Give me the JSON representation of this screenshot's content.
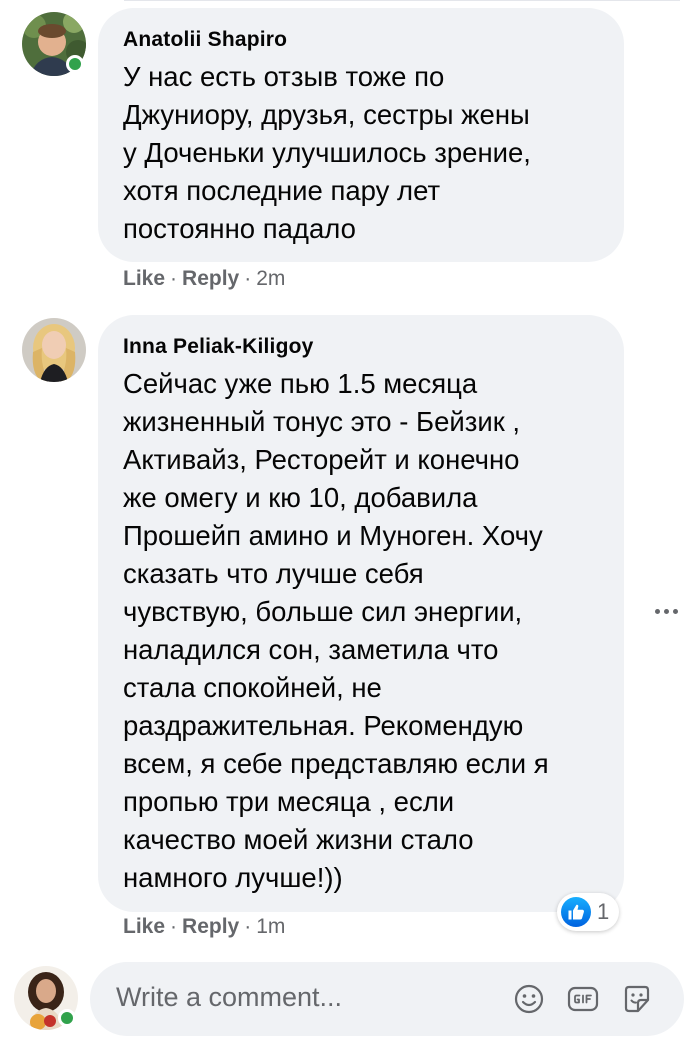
{
  "comments": [
    {
      "author": "Anatolii Shapiro",
      "online": true,
      "lines": [
        "У нас есть отзыв тоже по",
        "Джуниору, друзья, сестры жены",
        "у Доченьки улучшилось зрение,",
        "хотя последние пару лет",
        "постоянно падало"
      ],
      "like_label": "Like",
      "reply_label": "Reply",
      "time": "2m"
    },
    {
      "author": "Inna Peliak-Kiligoy",
      "online": false,
      "lines": [
        "Сейчас уже пью 1.5 месяца",
        "жизненный тонус это - Бейзик ,",
        "Активайз, Ресторейт и конечно",
        "же омегу и кю 10, добавила",
        "Прошейп амино и Муноген. Хочу",
        "сказать что лучше себя",
        "чувствую, больше сил энергии,",
        "наладился сон, заметила что",
        "стала спокойней, не",
        "раздражительная. Рекомендую",
        "всем, я себе представляю если я",
        "пропью три месяца , если",
        "качество моей жизни стало",
        "намного лучше!))"
      ],
      "like_label": "Like",
      "reply_label": "Reply",
      "time": "1m",
      "reaction": {
        "icon": "thumbs-up-icon",
        "count": "1",
        "color": "#1877f2"
      }
    }
  ],
  "composer": {
    "placeholder": "Write a comment...",
    "icons": [
      "emoji-icon",
      "gif-icon",
      "sticker-icon"
    ]
  },
  "colors": {
    "bubble": "#f0f2f5",
    "secondary_text": "#65676b",
    "online": "#31a24c",
    "like_blue": "#1877f2"
  }
}
